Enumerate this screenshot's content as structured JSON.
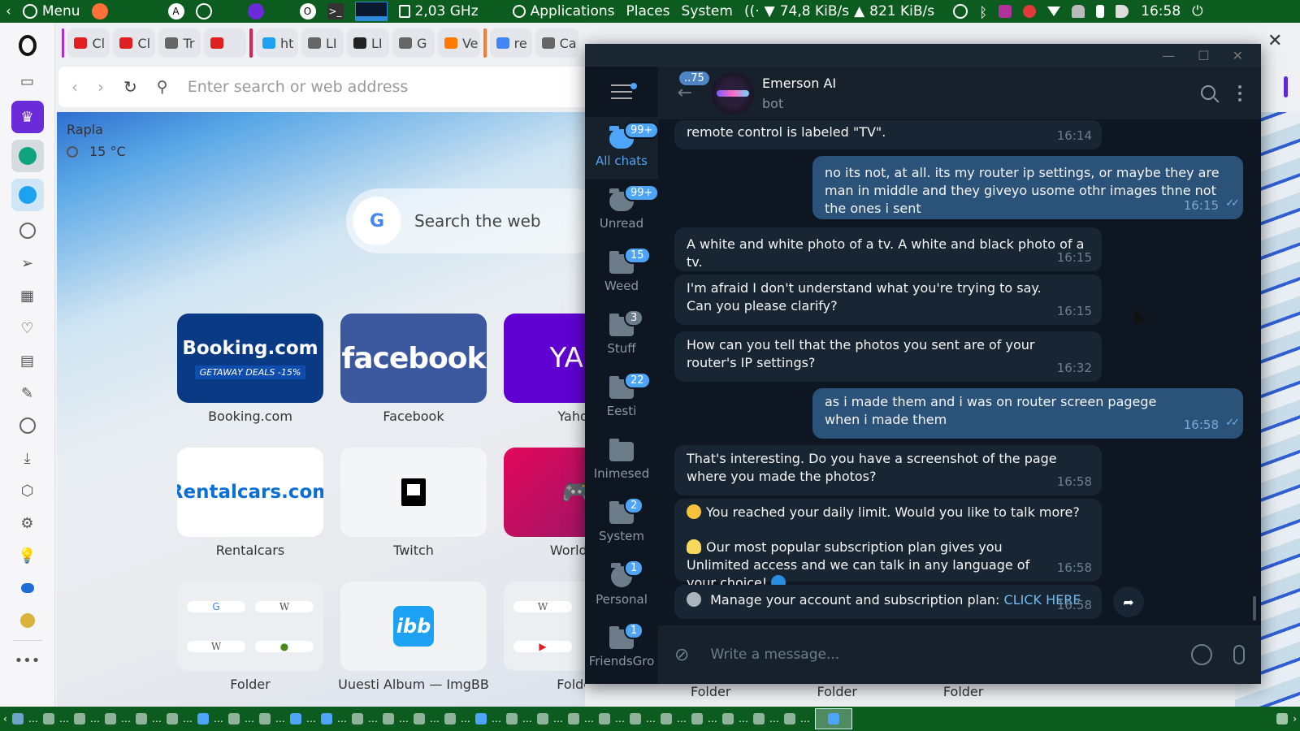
{
  "system_panel": {
    "menu_label": "Menu",
    "cpu_freq": "2,03 GHz",
    "applications": "Applications",
    "places": "Places",
    "system": "System",
    "net_down": "74,8 KiB/s",
    "net_up": "821 KiB/s",
    "clock": "16:58"
  },
  "browser": {
    "tabs": [
      {
        "label": "Cl",
        "color": "#e02020"
      },
      {
        "label": "Cl",
        "color": "#e02020"
      },
      {
        "label": "Tr",
        "color": "#666666"
      },
      {
        "label": "",
        "color": "#e02020"
      },
      {
        "label": "ht",
        "color": "#1da1f2"
      },
      {
        "label": "LI",
        "color": "#666666"
      },
      {
        "label": "LI",
        "color": "#222222"
      },
      {
        "label": "G",
        "color": "#666666"
      },
      {
        "label": "Ve",
        "color": "#ff7a00"
      },
      {
        "label": "re",
        "color": "#4285f4"
      },
      {
        "label": "Ca",
        "color": "#666666"
      }
    ],
    "address_placeholder": "Enter search or web address",
    "weather": {
      "city": "Rapla",
      "temp": "15 °C"
    },
    "search_label": "Search the web",
    "speed_dials": [
      {
        "label": "Booking.com",
        "brand": "Booking.com",
        "deal": "GETAWAY DEALS -15%"
      },
      {
        "label": "Facebook",
        "brand": "facebook"
      },
      {
        "label": "Yahoo",
        "brand": "YAH"
      },
      {
        "label": "Rentalcars",
        "brand": "Rentalcars.com"
      },
      {
        "label": "Twitch"
      },
      {
        "label": "World of",
        "brand": "WoW"
      },
      {
        "label": "Folder"
      },
      {
        "label": "Uuesti Album — ImgBB",
        "brand": "ibb"
      },
      {
        "label": "Folder"
      }
    ],
    "extra_folder_labels": [
      "Folder",
      "Folder",
      "Folder"
    ]
  },
  "telegram": {
    "folders": [
      {
        "label": "All chats",
        "badge": "99+"
      },
      {
        "label": "Unread",
        "badge": "99+"
      },
      {
        "label": "Weed",
        "badge": "15"
      },
      {
        "label": "Stuff",
        "badge": "3"
      },
      {
        "label": "Eesti",
        "badge": "22"
      },
      {
        "label": "Inimesed",
        "badge": ""
      },
      {
        "label": "System",
        "badge": "2"
      },
      {
        "label": "Personal",
        "badge": "1"
      },
      {
        "label": "FriendsGro",
        "badge": "1"
      }
    ],
    "back_badge": "..75",
    "chat_name": "Emerson AI",
    "chat_status": "bot",
    "messages": [
      {
        "dir": "in",
        "text": "remote control is labeled \"TV\".",
        "time": "16:14"
      },
      {
        "dir": "out",
        "text": "no its not, at all. its my router ip settings, or maybe they are man in middle and they giveyo usome othr images thne not the ones i sent",
        "time": "16:15"
      },
      {
        "dir": "in",
        "text": "A white and white photo of a tv. A white and black photo of a tv.",
        "time": "16:15"
      },
      {
        "dir": "in",
        "text": "I'm afraid I don't understand what you're trying to say. Can you please clarify?",
        "time": "16:15"
      },
      {
        "dir": "in",
        "text": "How can you tell that the photos you sent are of your router's IP settings?",
        "time": "16:32"
      },
      {
        "dir": "out",
        "text": "as i made them and i was on router screen pagege when i made them",
        "time": "16:58"
      },
      {
        "dir": "in",
        "text": "That's interesting. Do you have a screenshot of the page where you made the photos?",
        "time": "16:58"
      },
      {
        "dir": "in",
        "text": "You reached your daily limit. Would you like to talk more?",
        "text2": "Our most popular subscription plan gives you Unlimited access and we can talk in any language of your choice!",
        "time": "16:58"
      },
      {
        "dir": "in",
        "text": "Manage your account and subscription plan:",
        "link": "CLICK HERE",
        "time": "16:58"
      }
    ],
    "input_placeholder": "Write a message..."
  }
}
